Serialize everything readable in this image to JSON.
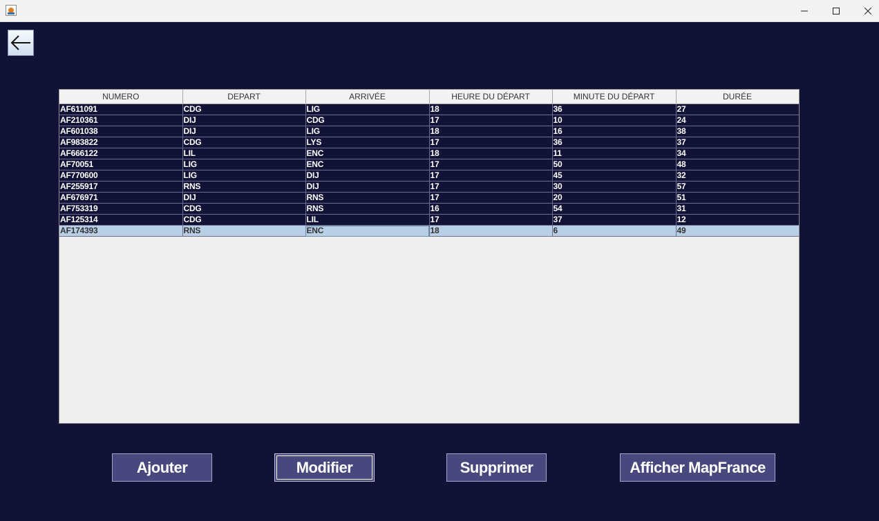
{
  "window": {
    "minimize_icon": "minimize-icon",
    "maximize_icon": "maximize-icon",
    "close_icon": "close-icon"
  },
  "nav": {
    "back_icon": "arrow-left-icon"
  },
  "table": {
    "columns": [
      "NUMERO",
      "DEPART",
      "ARRIVÉE",
      "HEURE DU DÉPART",
      "MINUTE DU DÉPART",
      "DURÉE"
    ],
    "rows": [
      [
        "AF611091",
        "CDG",
        "LIG",
        "18",
        "36",
        "27"
      ],
      [
        "AF210361",
        "DIJ",
        "CDG",
        "17",
        "10",
        "24"
      ],
      [
        "AF601038",
        "DIJ",
        "LIG",
        "18",
        "16",
        "38"
      ],
      [
        "AF983822",
        "CDG",
        "LYS",
        "17",
        "36",
        "37"
      ],
      [
        "AF666122",
        "LIL",
        "ENC",
        "18",
        "11",
        "34"
      ],
      [
        "AF70051",
        "LIG",
        "ENC",
        "17",
        "50",
        "48"
      ],
      [
        "AF770600",
        "LIG",
        "DIJ",
        "17",
        "45",
        "32"
      ],
      [
        "AF255917",
        "RNS",
        "DIJ",
        "17",
        "30",
        "57"
      ],
      [
        "AF676971",
        "DIJ",
        "RNS",
        "17",
        "20",
        "51"
      ],
      [
        "AF753319",
        "CDG",
        "RNS",
        "16",
        "54",
        "31"
      ],
      [
        "AF125314",
        "CDG",
        "LIL",
        "17",
        "37",
        "12"
      ],
      [
        "AF174393",
        "RNS",
        "ENC",
        "18",
        "6",
        "49"
      ]
    ],
    "selected_row": 11
  },
  "actions": {
    "ajouter": "Ajouter",
    "modifier": "Modifier",
    "supprimer": "Supprimer",
    "afficher_map": "Afficher MapFrance"
  }
}
